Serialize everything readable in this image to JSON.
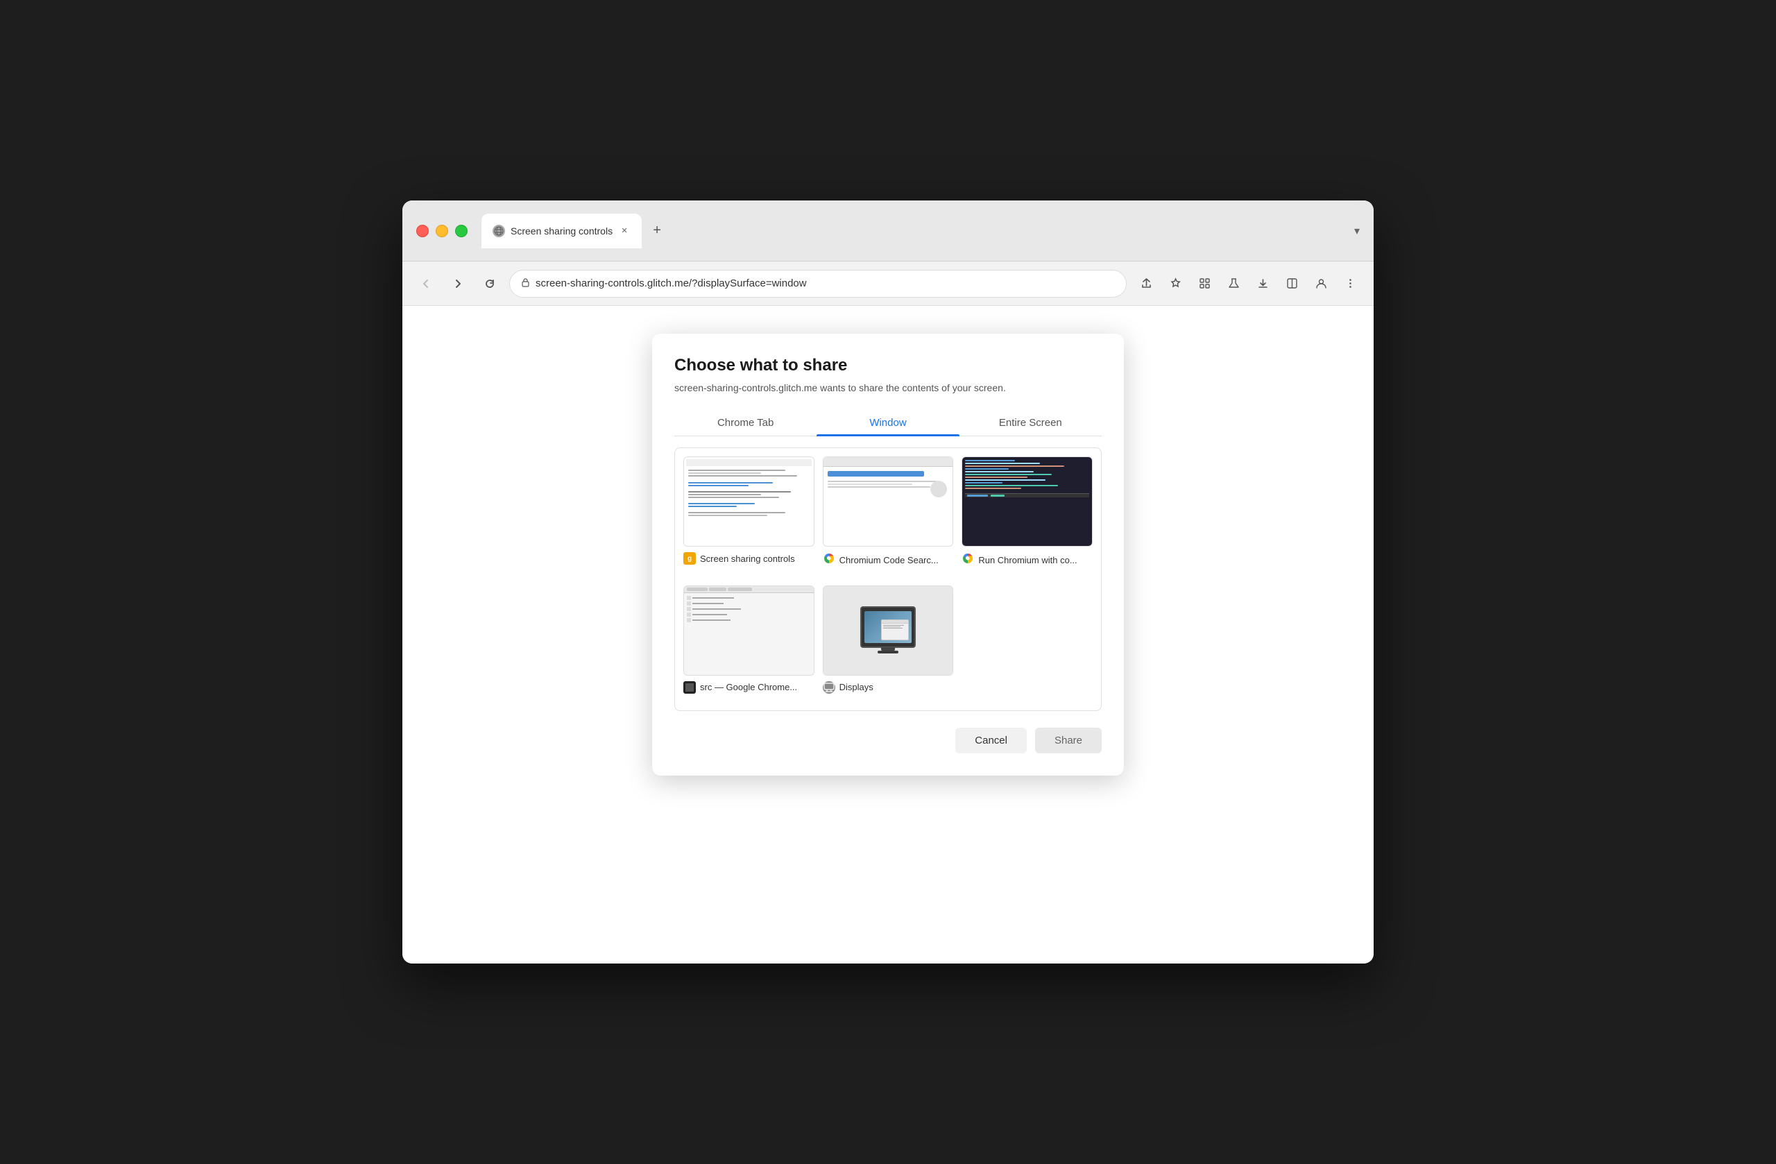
{
  "browser": {
    "tab": {
      "title": "Screen sharing controls",
      "favicon": "globe"
    },
    "new_tab_label": "+",
    "chevron": "▾",
    "nav": {
      "back_label": "←",
      "forward_label": "→",
      "reload_label": "↻",
      "url": "screen-sharing-controls.glitch.me/?displaySurface=window",
      "lock_icon": "🔒"
    },
    "actions": {
      "share_label": "⬆",
      "star_label": "☆",
      "puzzle_label": "⊞",
      "flask_label": "⚗",
      "download_label": "⬇",
      "split_label": "⊟",
      "profile_label": "👤",
      "menu_label": "⋮"
    }
  },
  "modal": {
    "title": "Choose what to share",
    "subtitle": "screen-sharing-controls.glitch.me wants to share the contents of your screen.",
    "tabs": [
      {
        "id": "chrome-tab",
        "label": "Chrome Tab",
        "active": false
      },
      {
        "id": "window",
        "label": "Window",
        "active": true
      },
      {
        "id": "entire-screen",
        "label": "Entire Screen",
        "active": false
      }
    ],
    "windows": [
      {
        "id": "screen-sharing-controls",
        "name": "Screen sharing controls",
        "icon_type": "glitch",
        "icon_label": "g"
      },
      {
        "id": "chromium-code-search",
        "name": "Chromium Code Searc...",
        "icon_type": "chrome",
        "icon_label": ""
      },
      {
        "id": "run-chromium",
        "name": "Run Chromium with co...",
        "icon_type": "chrome",
        "icon_label": ""
      },
      {
        "id": "src-google-chrome",
        "name": "src — Google Chrome...",
        "icon_type": "src",
        "icon_label": "■"
      },
      {
        "id": "displays",
        "name": "Displays",
        "icon_type": "displays",
        "icon_label": "⊙"
      }
    ],
    "buttons": {
      "cancel": "Cancel",
      "share": "Share"
    }
  }
}
